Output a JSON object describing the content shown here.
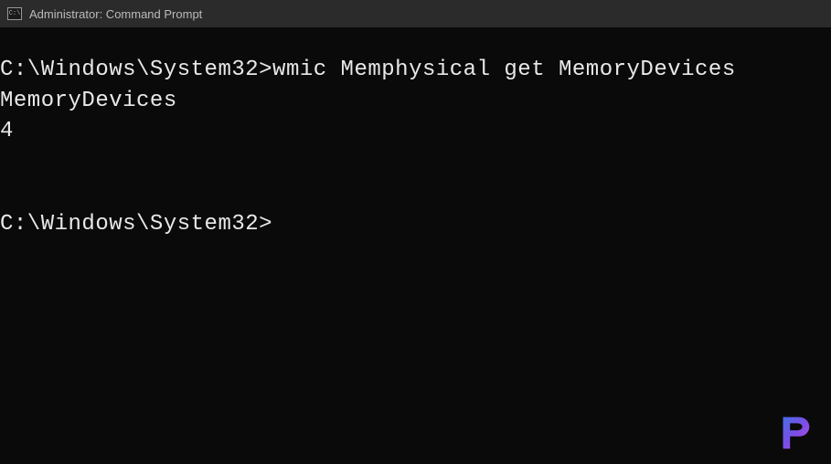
{
  "titlebar": {
    "icon_label": "C:\\",
    "title": "Administrator: Command Prompt"
  },
  "terminal": {
    "lines": [
      {
        "prompt": "C:\\Windows\\System32>",
        "command": "wmic Memphysical get MemoryDevices"
      },
      {
        "output": "MemoryDevices"
      },
      {
        "output": "4"
      },
      {
        "blank": true
      },
      {
        "blank": true
      },
      {
        "prompt": "C:\\Windows\\System32>",
        "command": ""
      }
    ]
  },
  "watermark": {
    "label": "P"
  }
}
